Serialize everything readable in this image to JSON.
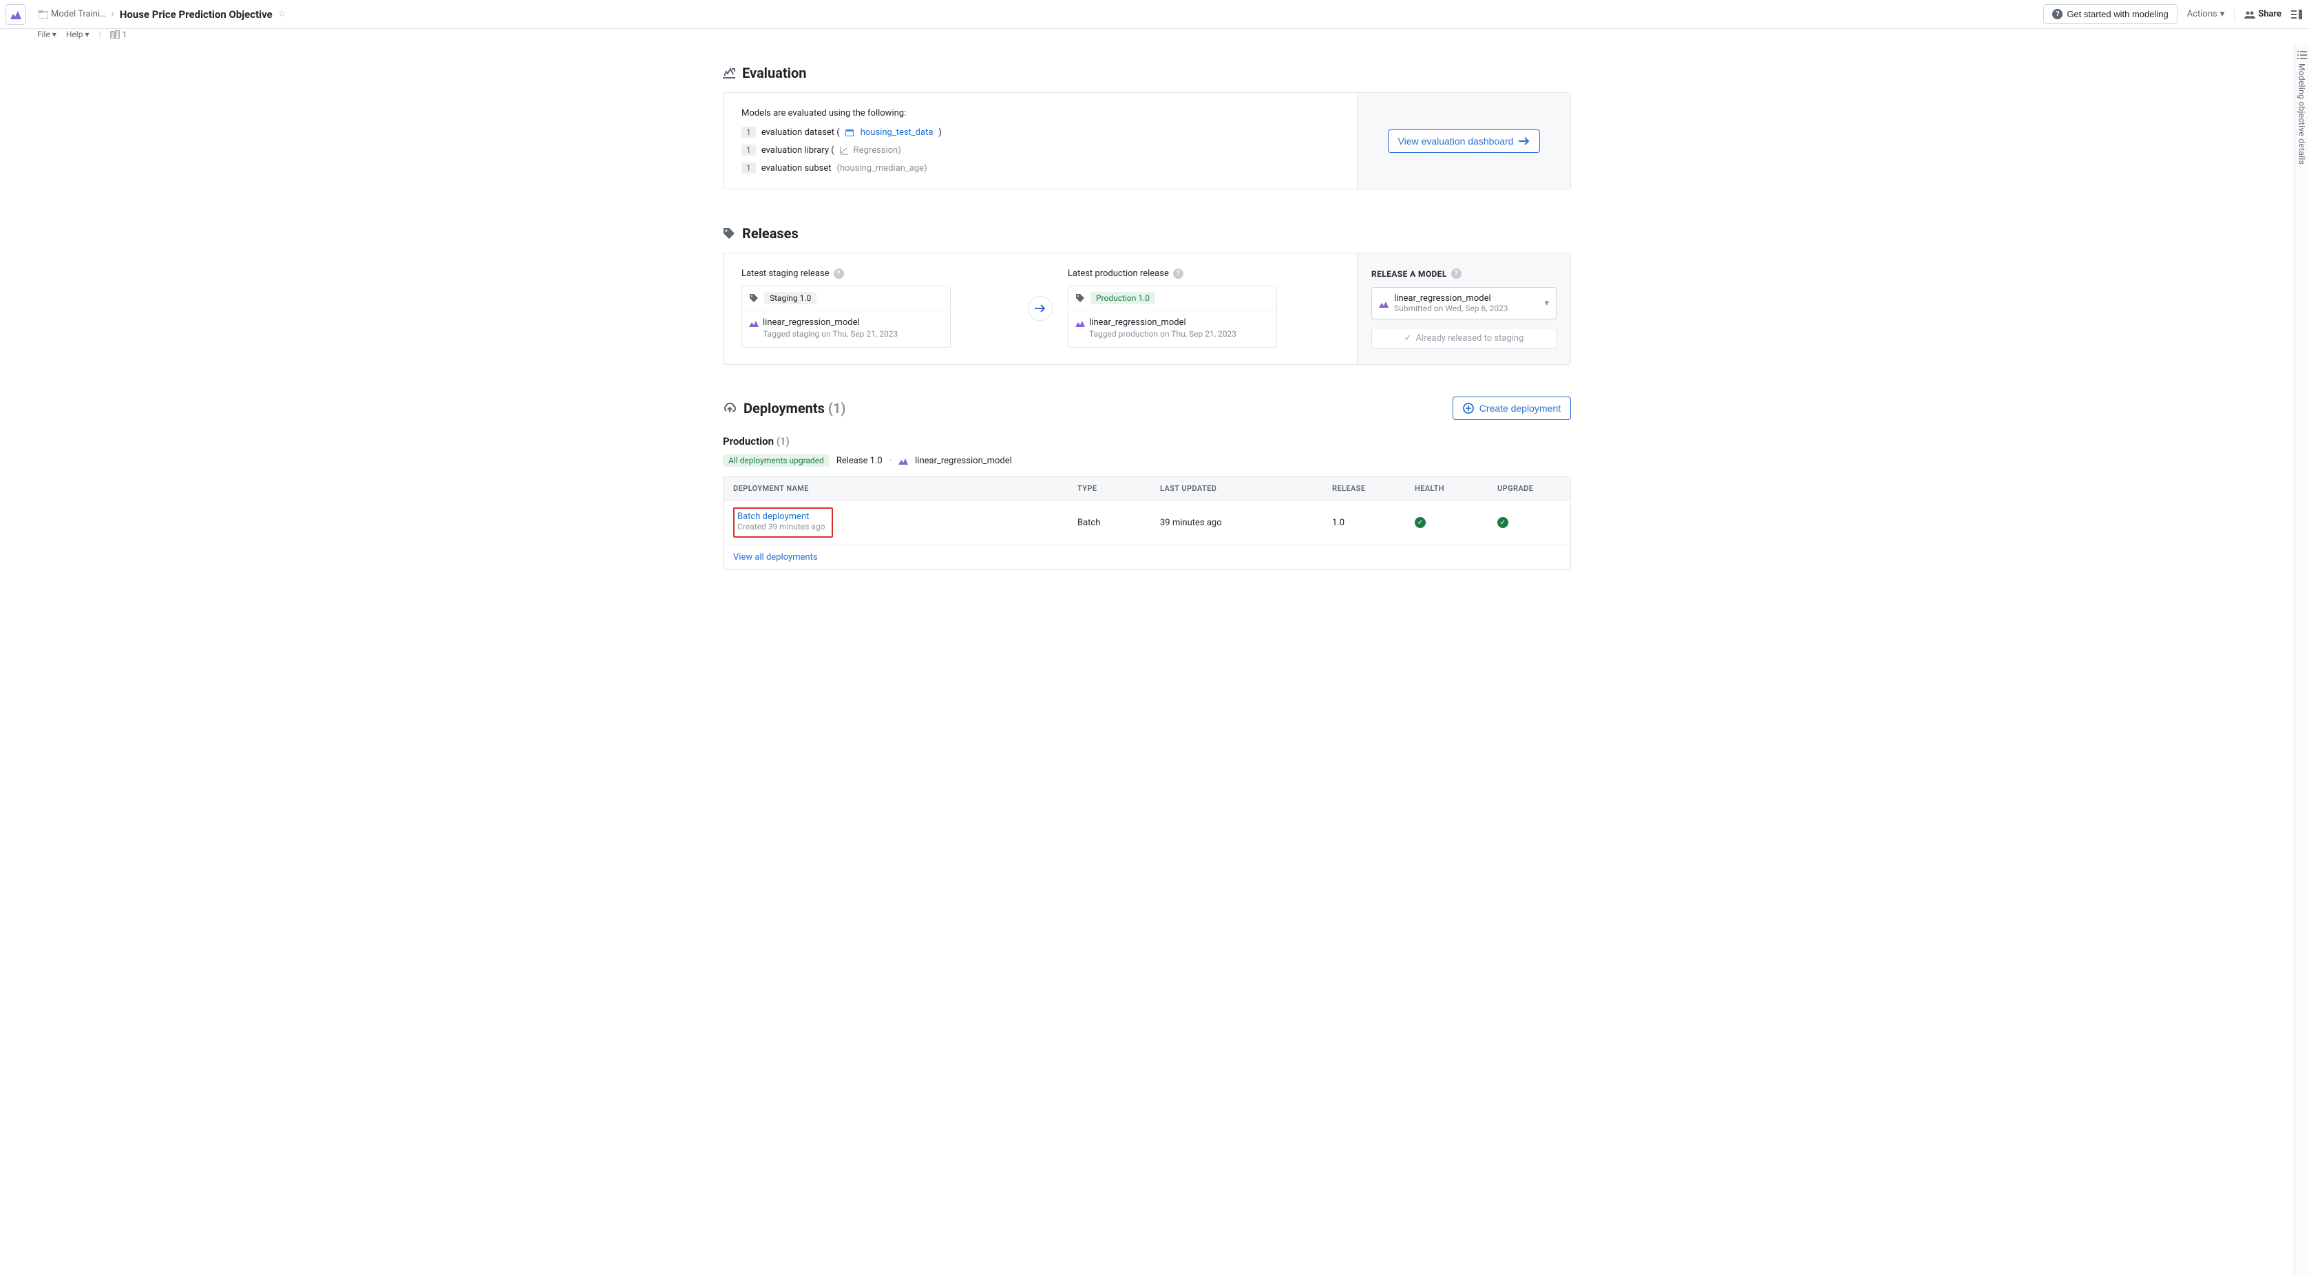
{
  "header": {
    "breadcrumb_parent": "Model Traini…",
    "title": "House Price Prediction Objective",
    "menus": {
      "file": "File",
      "help": "Help",
      "building_count": "1"
    },
    "get_started": "Get started with modeling",
    "actions": "Actions",
    "share": "Share"
  },
  "rsidebar": {
    "label": "Modeling objective details"
  },
  "evaluation": {
    "title": "Evaluation",
    "intro": "Models are evaluated using the following:",
    "dataset_label": "evaluation dataset (",
    "dataset_link": "housing_test_data",
    "dataset_close": ")",
    "library_label": "evaluation library (",
    "library_value": "Regression)",
    "subset_label": "evaluation subset ",
    "subset_value": "(housing_median_age)",
    "view_dash": "View evaluation dashboard"
  },
  "releases": {
    "title": "Releases",
    "staging_label": "Latest staging release",
    "prod_label": "Latest production release",
    "staging_tag": "Staging 1.0",
    "prod_tag": "Production 1.0",
    "model_name": "linear_regression_model",
    "staging_sub": "Tagged staging on Thu, Sep 21, 2023",
    "prod_sub": "Tagged production on Thu, Sep 21, 2023",
    "side_title": "RELEASE A MODEL",
    "sel_name": "linear_regression_model",
    "sel_sub": "Submitted on Wed, Sep 6, 2023",
    "already": "Already released to staging"
  },
  "deployments": {
    "title": "Deployments",
    "count": "(1)",
    "create": "Create deployment",
    "env": "Production",
    "env_count": "(1)",
    "upgraded": "All deployments upgraded",
    "release_tag": "Release 1.0",
    "model": "linear_regression_model",
    "columns": {
      "name": "DEPLOYMENT NAME",
      "type": "TYPE",
      "updated": "LAST UPDATED",
      "release": "RELEASE",
      "health": "HEALTH",
      "upgrade": "UPGRADE"
    },
    "row": {
      "name": "Batch deployment",
      "created": "Created 39 minutes ago",
      "type": "Batch",
      "updated": "39 minutes ago",
      "release": "1.0"
    },
    "view_all": "View all deployments"
  }
}
